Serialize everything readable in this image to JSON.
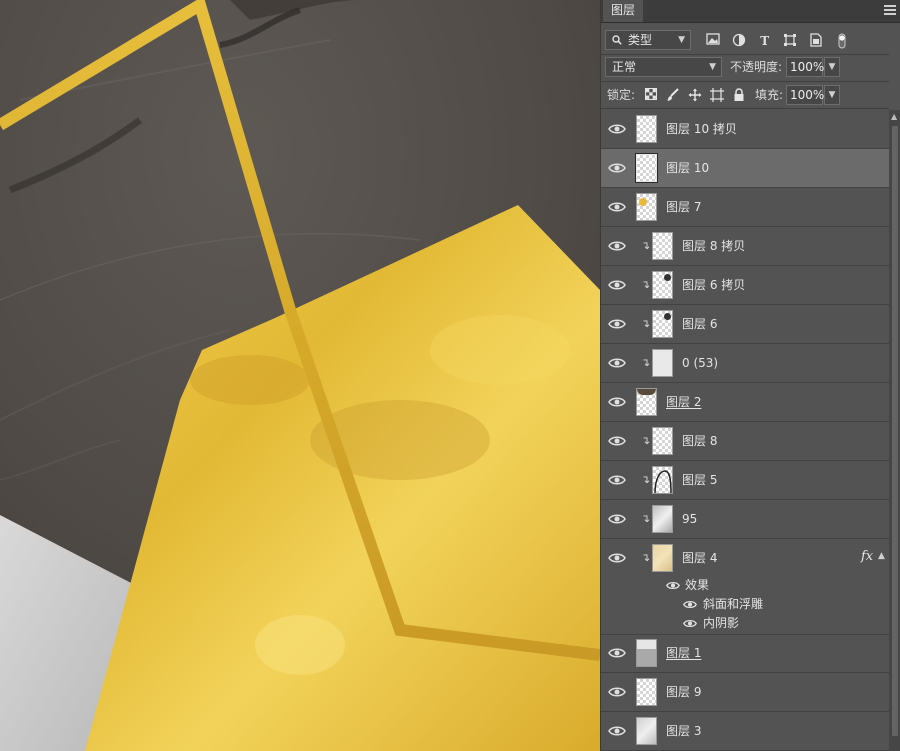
{
  "panel": {
    "tab_label": "图层"
  },
  "filter": {
    "kind_label": "类型",
    "icons": [
      "image-filter-icon",
      "adjustment-filter-icon",
      "type-filter-icon",
      "shape-filter-icon",
      "smart-object-filter-icon",
      "filter-toggle-icon"
    ]
  },
  "blend": {
    "mode": "正常",
    "opacity_label": "不透明度:",
    "opacity_value": "100%"
  },
  "lock": {
    "label": "锁定:",
    "icons": [
      "lock-transparent-icon",
      "lock-pixels-icon",
      "lock-position-icon",
      "lock-artboard-icon",
      "lock-all-icon"
    ],
    "fill_label": "填充:",
    "fill_value": "100%"
  },
  "layers": [
    {
      "name": "图层 10 拷贝",
      "clipped": false,
      "underline": false,
      "selected": false
    },
    {
      "name": "图层 10",
      "clipped": false,
      "underline": false,
      "selected": true
    },
    {
      "name": "图层 7",
      "clipped": false,
      "underline": false,
      "selected": false
    },
    {
      "name": "图层 8 拷贝",
      "clipped": true,
      "underline": false,
      "selected": false
    },
    {
      "name": "图层 6 拷贝",
      "clipped": true,
      "underline": false,
      "selected": false
    },
    {
      "name": "图层 6",
      "clipped": true,
      "underline": false,
      "selected": false
    },
    {
      "name": "0 (53)",
      "clipped": true,
      "underline": false,
      "selected": false
    },
    {
      "name": "图层 2",
      "clipped": false,
      "underline": true,
      "selected": false
    },
    {
      "name": "图层 8",
      "clipped": true,
      "underline": false,
      "selected": false
    },
    {
      "name": "图层 5",
      "clipped": true,
      "underline": false,
      "selected": false
    },
    {
      "name": "95",
      "clipped": true,
      "underline": false,
      "selected": false
    },
    {
      "name": "图层 4",
      "clipped": true,
      "underline": false,
      "selected": false,
      "fx": "fx"
    }
  ],
  "effects": {
    "header": "效果",
    "items": [
      "斜面和浮雕",
      "内阴影"
    ]
  },
  "layers_after": [
    {
      "name": "图层 1",
      "clipped": false,
      "underline": true,
      "selected": false
    },
    {
      "name": "图层 9",
      "clipped": false,
      "underline": false,
      "selected": false
    },
    {
      "name": "图层 3",
      "clipped": false,
      "underline": false,
      "selected": false
    }
  ],
  "colors": {
    "gold": "#e3bd3f",
    "marble": "#57524d",
    "panel": "#535353",
    "selected_row": "#6b6b6b"
  }
}
